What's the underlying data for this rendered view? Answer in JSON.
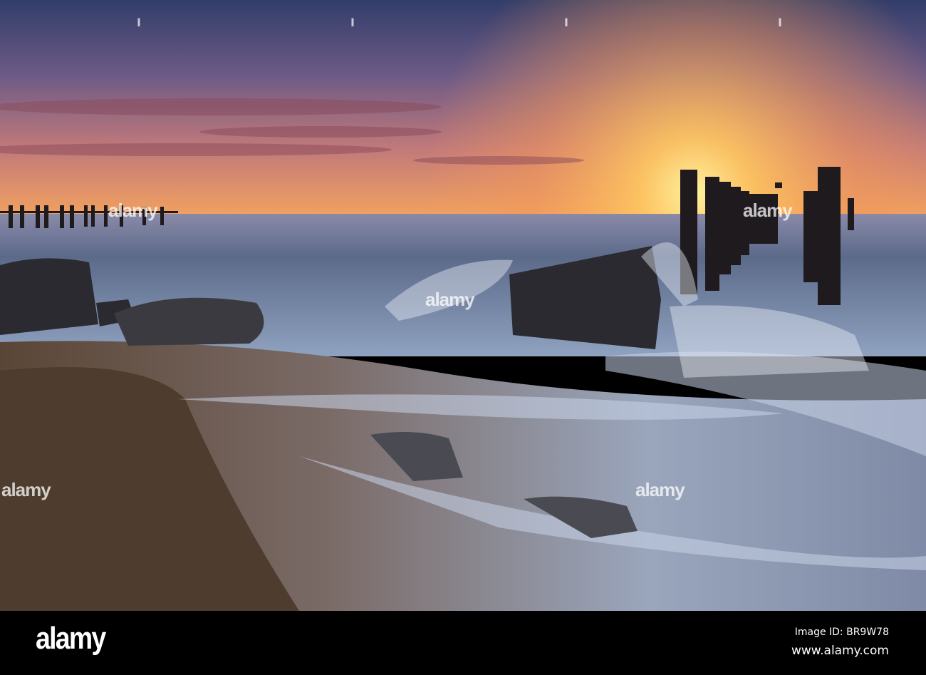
{
  "photo": {
    "subject": "sunset-beach-groynes"
  },
  "watermark": {
    "text": "alamy"
  },
  "footer": {
    "logo": "alamy",
    "image_id": "Image ID: BR9W78",
    "url": "www.alamy.com"
  }
}
